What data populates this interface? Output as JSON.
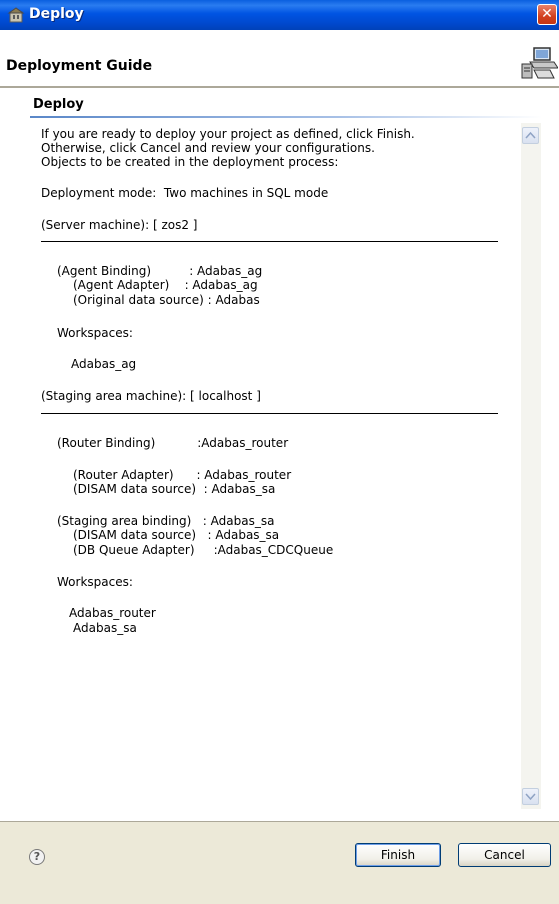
{
  "window": {
    "title": "Deploy",
    "close_label": "✕",
    "icon": "deploy-icon"
  },
  "header": {
    "title": "Deployment Guide",
    "icon": "computer-icon"
  },
  "section": {
    "title": "Deploy"
  },
  "deployment_text": {
    "intro_1": "If you are ready to deploy your project as defined, click Finish.",
    "intro_2": "Otherwise, click Cancel and review your configurations.",
    "intro_3": "Objects to be created in the deployment process:",
    "mode": "Deployment mode:  Two machines in SQL mode",
    "server_machine": "(Server machine): [ zos2 ]",
    "agent_binding": "(Agent Binding)          : Adabas_ag",
    "agent_adapter": "(Agent Adapter)    : Adabas_ag",
    "original_source": "(Original data source) : Adabas",
    "workspaces_label_1": "Workspaces:",
    "workspace_ag": "Adabas_ag",
    "staging_machine": "(Staging area machine): [ localhost ]",
    "router_binding": "(Router Binding)           :Adabas_router",
    "router_adapter": "(Router Adapter)      : Adabas_router",
    "disam_source_1": "(DISAM data source)  : Adabas_sa",
    "staging_binding": "(Staging area binding)   : Adabas_sa",
    "disam_source_2": "(DISAM data source)   : Adabas_sa",
    "db_queue_adapter": "(DB Queue Adapter)     :Adabas_CDCQueue",
    "workspaces_label_2": "Workspaces:",
    "workspace_router": "Adabas_router",
    "workspace_sa": "Adabas_sa"
  },
  "footer": {
    "help_label": "?",
    "finish_label": "Finish",
    "cancel_label": "Cancel"
  }
}
